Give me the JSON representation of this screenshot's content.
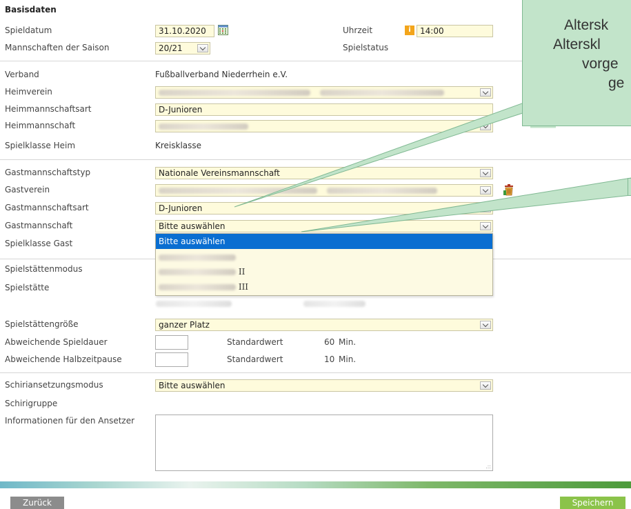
{
  "section_title": "Basisdaten",
  "labels": {
    "spieldatum": "Spieldatum",
    "mannschaften_saison": "Mannschaften der Saison",
    "uhrzeit": "Uhrzeit",
    "spielstatus": "Spielstatus",
    "verband": "Verband",
    "heimverein": "Heimverein",
    "heimmannschaftsart": "Heimmannschaftsart",
    "heimmannschaft": "Heimmannschaft",
    "spielklasse_heim": "Spielklasse Heim",
    "gastmannschaftstyp": "Gastmannschaftstyp",
    "gastverein": "Gastverein",
    "gastmannschaftsart": "Gastmannschaftsart",
    "gastmannschaft": "Gastmannschaft",
    "spielklasse_gast": "Spielklasse Gast",
    "spielstaettenmodus": "Spielstättenmodus",
    "spielstaette": "Spielstätte",
    "spielstaettengroesse": "Spielstättengröße",
    "abw_spieldauer": "Abweichende Spieldauer",
    "abw_halbzeit": "Abweichende Halbzeitpause",
    "schiri_modus": "Schiriansetzungsmodus",
    "schirigruppe": "Schirigruppe",
    "informationen": "Informationen für den Ansetzer"
  },
  "values": {
    "spieldatum": "31.10.2020",
    "mannschaften_saison": "20/21",
    "uhrzeit": "14:00",
    "verband": "Fußballverband Niederrhein e.V.",
    "heimmannschaftsart": "D-Junioren",
    "spielklasse_heim": "Kreisklasse",
    "gastmannschaftstyp": "Nationale Vereinsmannschaft",
    "gastmannschaftsart": "D-Junioren",
    "gastmannschaft": "Bitte auswählen",
    "spielstaettengroesse": "ganzer Platz",
    "spieldauer_standard_label": "Standardwert",
    "spieldauer_standard_value": "60",
    "spieldauer_unit": "Min.",
    "halbzeit_standard_label": "Standardwert",
    "halbzeit_standard_value": "10",
    "halbzeit_unit": "Min.",
    "schiri_modus": "Bitte auswählen"
  },
  "dropdown": {
    "selected": "Bitte auswählen",
    "option2_suffix": "II",
    "option3_suffix": "III"
  },
  "buttons": {
    "back": "Zurück",
    "save": "Speichern"
  },
  "callout_lines": [
    "Altersk",
    "Alterskl",
    "vorge",
    "ge"
  ],
  "colors": {
    "field_bg": "#fefbdc",
    "dropdown_highlight": "#0a6ed1",
    "save_button": "#8bc34a",
    "back_button": "#8c8c8c",
    "callout_bg": "#c2e4ca",
    "clock_icon": "#f3a51b"
  }
}
